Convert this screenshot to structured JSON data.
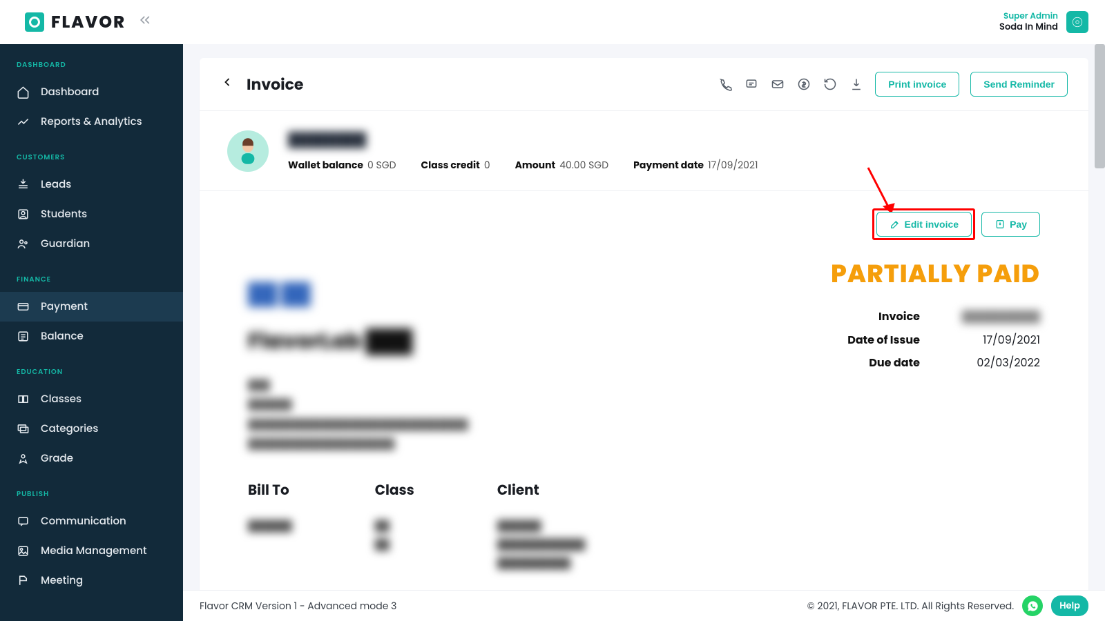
{
  "brand": {
    "name": "FLAVOR"
  },
  "user": {
    "role": "Super Admin",
    "org": "Soda In Mind"
  },
  "sidebar": {
    "sections": [
      {
        "label": "DASHBOARD",
        "items": [
          {
            "label": "Dashboard",
            "icon": "home"
          },
          {
            "label": "Reports & Analytics",
            "icon": "chart"
          }
        ]
      },
      {
        "label": "CUSTOMERS",
        "items": [
          {
            "label": "Leads",
            "icon": "leads"
          },
          {
            "label": "Students",
            "icon": "user"
          },
          {
            "label": "Guardian",
            "icon": "shield"
          }
        ]
      },
      {
        "label": "FINANCE",
        "items": [
          {
            "label": "Payment",
            "icon": "card",
            "active": true
          },
          {
            "label": "Balance",
            "icon": "balance"
          }
        ]
      },
      {
        "label": "EDUCATION",
        "items": [
          {
            "label": "Classes",
            "icon": "book"
          },
          {
            "label": "Categories",
            "icon": "layers"
          },
          {
            "label": "Grade",
            "icon": "grade"
          }
        ]
      },
      {
        "label": "PUBLISH",
        "items": [
          {
            "label": "Communication",
            "icon": "chat"
          },
          {
            "label": "Media Management",
            "icon": "media"
          },
          {
            "label": "Meeting",
            "icon": "meeting"
          }
        ]
      }
    ]
  },
  "header": {
    "title": "Invoice",
    "print_label": "Print invoice",
    "reminder_label": "Send Reminder"
  },
  "customer": {
    "name_masked": "████████",
    "wallet_label": "Wallet balance",
    "wallet_value": "0 SGD",
    "credit_label": "Class credit",
    "credit_value": "0",
    "amount_label": "Amount",
    "amount_value": "40.00 SGD",
    "paydate_label": "Payment date",
    "paydate_value": "17/09/2021"
  },
  "invoice": {
    "edit_label": "Edit invoice",
    "pay_label": "Pay",
    "status": "PARTIALLY PAID",
    "meta": {
      "invoice_label": "Invoice",
      "invoice_value_masked": "██████████",
      "issue_label": "Date of Issue",
      "issue_value": "17/09/2021",
      "due_label": "Due date",
      "due_value": "02/03/2022"
    },
    "company": {
      "logo_masked": "██ ██",
      "name_masked": "FlavorLab ███",
      "address_masked": "███\n██████\n██████████████████████████████\n████████████████████"
    },
    "columns": {
      "bill_to": {
        "label": "Bill To",
        "value_masked": "██████"
      },
      "class": {
        "label": "Class",
        "value_masked": "██\n██"
      },
      "client": {
        "label": "Client",
        "value_masked": "██████\n████████████\n██████████"
      }
    }
  },
  "footer": {
    "left": "Flavor CRM Version 1 - Advanced mode 3",
    "right": "© 2021, FLAVOR PTE. LTD. All Rights Reserved.",
    "help": "Help"
  },
  "annotation": {
    "target": "edit-invoice-button",
    "style": "red-box-with-arrow"
  }
}
